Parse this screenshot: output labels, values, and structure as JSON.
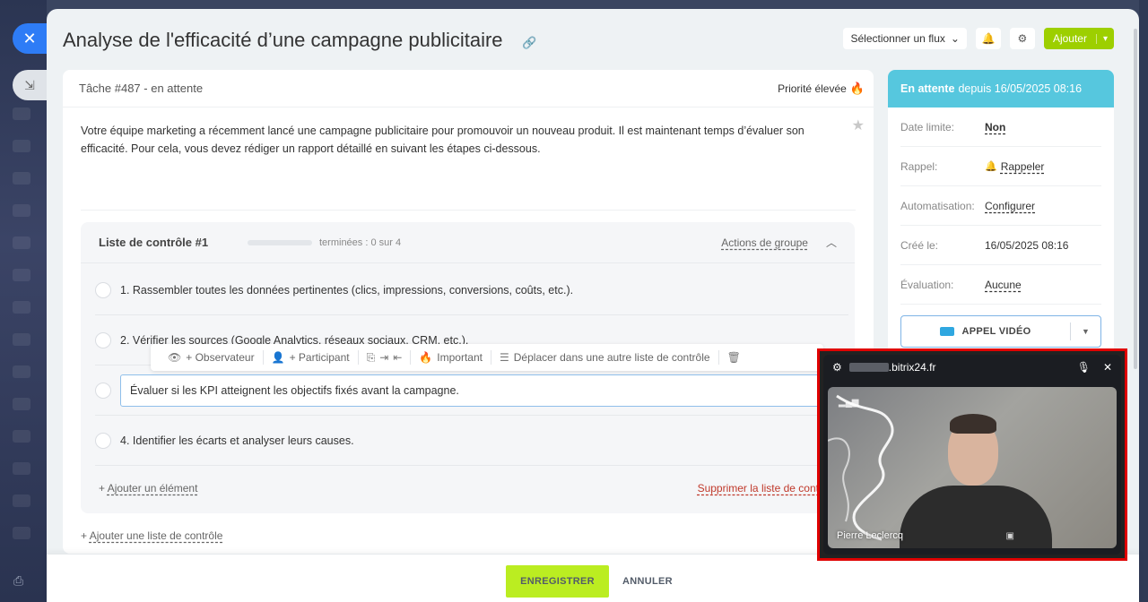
{
  "header": {
    "title": "Analyse de l'efficacité d’une campagne publicitaire",
    "flow_select": "Sélectionner un flux",
    "add_button": "Ajouter"
  },
  "task": {
    "number_status": "Tâche #487 - en attente",
    "priority": "Priorité élevée",
    "description": "Votre équipe marketing a récemment lancé une campagne publicitaire pour promouvoir un nouveau produit. Il est maintenant temps d’évaluer son efficacité. Pour cela, vous devez rédiger un rapport détaillé en suivant les étapes ci-dessous."
  },
  "checklist": {
    "title": "Liste de contrôle #1",
    "progress_text": "terminées : 0 sur 4",
    "progress_fraction": 0,
    "group_actions": "Actions de groupe",
    "items": [
      {
        "text": "1. Rassembler toutes les données pertinentes (clics, impressions, conversions, coûts, etc.)."
      },
      {
        "text": "2. Vérifier les sources (Google Analytics, réseaux sociaux, CRM, etc.)."
      },
      {
        "text": "Évaluer si les KPI atteignent les objectifs fixés avant la campagne."
      },
      {
        "text": "4. Identifier les écarts et analyser leurs causes."
      }
    ],
    "toolbar": {
      "observer": "+ Observateur",
      "participant": "+ Participant",
      "important": "Important",
      "move": "Déplacer dans une autre liste de contrôle"
    },
    "add_item": "Ajouter un élément",
    "delete_list": "Supprimer la liste de contrôle",
    "add_list": "Ajouter une liste de contrôle"
  },
  "sidebar": {
    "status_bold": "En attente",
    "status_rest": "depuis 16/05/2025 08:16",
    "rows": [
      {
        "label": "Date limite:",
        "value": "Non"
      },
      {
        "label": "Rappel:",
        "value": "Rappeler"
      },
      {
        "label": "Automatisation:",
        "value": "Configurer"
      },
      {
        "label": "Créé le:",
        "value": "16/05/2025 08:16"
      },
      {
        "label": "Évaluation:",
        "value": "Aucune"
      }
    ],
    "video_call": "APPEL VIDÉO"
  },
  "footer": {
    "save": "ENREGISTRER",
    "cancel": "ANNULER"
  },
  "video_popup": {
    "url": ".bitrix24.fr",
    "caller": "Pierre Leclercq"
  },
  "colors": {
    "accent_blue": "#2e7cf6",
    "status_cyan": "#56c7de",
    "save_green": "#bbed21",
    "add_green": "#9dcf00",
    "popup_border": "#e00000"
  }
}
